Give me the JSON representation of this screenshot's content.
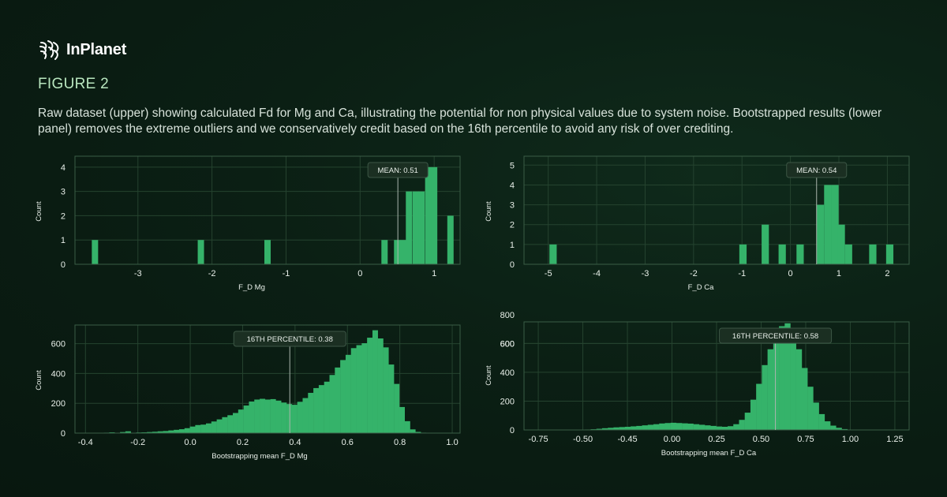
{
  "brand": {
    "name": "InPlanet",
    "logo_icon": "inplanet-swirl-icon"
  },
  "figure_label": "FIGURE 2",
  "caption": "Raw dataset (upper) showing calculated Fd for Mg and Ca, illustrating the potential for non physical values due to system noise. Bootstrapped results (lower panel) removes the extreme outliers and we conservatively credit based on the 16th percentile to avoid any risk of over crediting.",
  "colors": {
    "bar": "#35b36a",
    "bar_alt": "#2e9f5c",
    "grid": "#25432f",
    "frame": "#3a5d46",
    "annotation_bg": "#1b2f22",
    "annotation_line": "#aab5ad"
  },
  "chart_data": [
    {
      "id": "raw-mg",
      "type": "bar",
      "xlabel": "F_D Mg",
      "ylabel": "Count",
      "xlim": [
        -3.85,
        1.35
      ],
      "ylim": [
        0,
        4.45
      ],
      "xticks": [
        -3,
        -2,
        -1,
        0,
        1
      ],
      "yticks": [
        0,
        1,
        2,
        3,
        4
      ],
      "bin_width": 0.085,
      "bins": [
        {
          "x": -3.58,
          "count": 1
        },
        {
          "x": -2.15,
          "count": 1
        },
        {
          "x": -1.25,
          "count": 1
        },
        {
          "x": 0.33,
          "count": 1
        },
        {
          "x": 0.5,
          "count": 1
        },
        {
          "x": 0.58,
          "count": 1
        },
        {
          "x": 0.66,
          "count": 3
        },
        {
          "x": 0.75,
          "count": 3
        },
        {
          "x": 0.83,
          "count": 3
        },
        {
          "x": 0.92,
          "count": 4
        },
        {
          "x": 1.0,
          "count": 4
        },
        {
          "x": 1.22,
          "count": 2
        }
      ],
      "annotation": {
        "label": "MEAN: 0.51",
        "x": 0.51
      }
    },
    {
      "id": "raw-ca",
      "type": "bar",
      "xlabel": "F_D Ca",
      "ylabel": "Count",
      "xlim": [
        -5.5,
        2.45
      ],
      "ylim": [
        0,
        5.45
      ],
      "xticks": [
        -5,
        -4,
        -3,
        -2,
        -1,
        0,
        1,
        2
      ],
      "yticks": [
        0,
        1,
        2,
        3,
        4,
        5
      ],
      "bin_width": 0.15,
      "bins": [
        {
          "x": -4.9,
          "count": 1
        },
        {
          "x": -0.98,
          "count": 1
        },
        {
          "x": -0.52,
          "count": 2
        },
        {
          "x": -0.17,
          "count": 1
        },
        {
          "x": 0.2,
          "count": 1
        },
        {
          "x": 0.62,
          "count": 3
        },
        {
          "x": 0.77,
          "count": 4
        },
        {
          "x": 0.92,
          "count": 4
        },
        {
          "x": 1.05,
          "count": 2
        },
        {
          "x": 1.2,
          "count": 1
        },
        {
          "x": 1.7,
          "count": 1
        },
        {
          "x": 2.05,
          "count": 1
        }
      ],
      "annotation": {
        "label": "MEAN: 0.54",
        "x": 0.54
      }
    },
    {
      "id": "boot-mg",
      "type": "bar",
      "xlabel": "Bootstrapping mean F_D Mg",
      "ylabel": "Count",
      "xlim": [
        -0.44,
        1.03
      ],
      "ylim": [
        0,
        725
      ],
      "xticks": [
        -0.4,
        -0.2,
        0.0,
        0.2,
        0.4,
        0.6,
        0.8,
        1.0
      ],
      "xtick_labels": [
        "-0.4",
        "-0.2",
        "0.0",
        "0.2",
        "0.4",
        "0.6",
        "0.8",
        "1.0"
      ],
      "yticks": [
        0,
        200,
        400,
        600
      ],
      "bin_width": 0.0205,
      "bin_start": -0.35,
      "counts": [
        1,
        3,
        5,
        2,
        7,
        12,
        2,
        4,
        5,
        7,
        9,
        12,
        14,
        18,
        22,
        26,
        33,
        44,
        54,
        57,
        65,
        78,
        92,
        107,
        120,
        135,
        158,
        185,
        212,
        225,
        230,
        225,
        228,
        218,
        205,
        195,
        190,
        210,
        235,
        270,
        302,
        322,
        345,
        390,
        440,
        490,
        525,
        570,
        590,
        603,
        640,
        690,
        635,
        575,
        460,
        330,
        175,
        80,
        25,
        8,
        3
      ],
      "annotation": {
        "label": "16TH PERCENTILE: 0.38",
        "x": 0.38
      }
    },
    {
      "id": "boot-ca",
      "type": "bar",
      "xlabel": "Bootstrapping mean F_D Ca",
      "ylabel": "Count",
      "xlim": [
        -0.83,
        1.33
      ],
      "ylim": [
        0,
        750
      ],
      "xticks": [
        -0.75,
        -0.5,
        -0.25,
        0.0,
        0.25,
        0.5,
        0.75,
        1.0,
        1.25
      ],
      "xtick_labels": [
        "-0.75",
        "-0.50",
        "-0.45",
        "0.00",
        "0.25",
        "0.50",
        "0.75",
        "1.00",
        "1.25"
      ],
      "yticks": [
        0,
        200,
        400,
        600,
        800,
        600
      ],
      "bin_width": 0.032,
      "bin_start": -0.52,
      "counts": [
        2,
        3,
        5,
        8,
        12,
        15,
        18,
        20,
        22,
        25,
        28,
        32,
        36,
        40,
        45,
        48,
        50,
        48,
        46,
        44,
        40,
        36,
        32,
        28,
        24,
        22,
        26,
        40,
        70,
        120,
        210,
        320,
        450,
        560,
        640,
        720,
        740,
        680,
        560,
        430,
        300,
        190,
        110,
        60,
        30,
        15,
        6,
        2
      ],
      "annotation": {
        "label": "16TH PERCENTILE: 0.58",
        "x": 0.58
      }
    }
  ]
}
